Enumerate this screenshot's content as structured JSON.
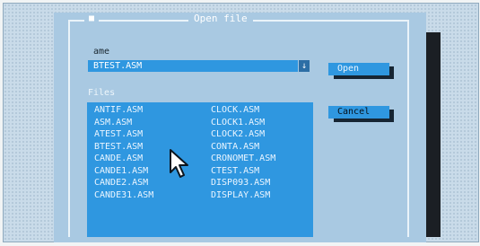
{
  "dialog": {
    "title": "Open file",
    "close_glyph": "■"
  },
  "name_field": {
    "label": "ame",
    "value": "BTEST.ASM",
    "arrow_glyph": "↓"
  },
  "files": {
    "label": "Files",
    "columns": [
      [
        "ANTIF.ASM",
        "ASM.ASM",
        "ATEST.ASM",
        "BTEST.ASM",
        "CANDE.ASM",
        "CANDE1.ASM",
        "CANDE2.ASM",
        "CANDE31.ASM"
      ],
      [
        "CLOCK.ASM",
        "CLOCK1.ASM",
        "CLOCK2.ASM",
        "CONTA.ASM",
        "CRONOMET.ASM",
        "CTEST.ASM",
        "DISP093.ASM",
        "DISPLAY.ASM"
      ]
    ]
  },
  "buttons": {
    "open": "Open",
    "cancel": "Cancel"
  },
  "icons": {
    "cursor": "mouse-pointer-icon",
    "close": "close-box-icon",
    "dropdown": "dropdown-arrow-icon"
  }
}
